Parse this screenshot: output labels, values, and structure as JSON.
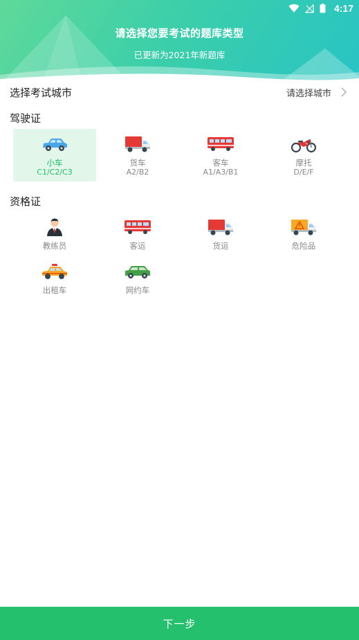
{
  "status": {
    "time": "4:17"
  },
  "header": {
    "title": "请选择您要考试的题库类型",
    "subtitle": "已更新为2021年新题库"
  },
  "city": {
    "label": "选择考试城市",
    "placeholder": "请选择城市"
  },
  "license": {
    "title": "驾驶证",
    "items": [
      {
        "label": "小车",
        "sub": "C1/C2/C3",
        "icon": "car-icon",
        "selected": true
      },
      {
        "label": "货车",
        "sub": "A2/B2",
        "icon": "truck-icon"
      },
      {
        "label": "客车",
        "sub": "A1/A3/B1",
        "icon": "bus-icon"
      },
      {
        "label": "摩托",
        "sub": "D/E/F",
        "icon": "motorcycle-icon"
      }
    ]
  },
  "qualification": {
    "title": "资格证",
    "items": [
      {
        "label": "教练员",
        "icon": "instructor-icon"
      },
      {
        "label": "客运",
        "icon": "bus-icon"
      },
      {
        "label": "货运",
        "icon": "truck-icon"
      },
      {
        "label": "危险品",
        "icon": "hazmat-truck-icon"
      },
      {
        "label": "出租车",
        "icon": "taxi-icon"
      },
      {
        "label": "网约车",
        "icon": "rideshare-car-icon"
      }
    ]
  },
  "footer": {
    "next_label": "下一步"
  },
  "colors": {
    "accent": "#25c06d",
    "selected_bg": "#e2f7ea",
    "header_from": "#5fd99a",
    "header_to": "#28c4c4"
  }
}
